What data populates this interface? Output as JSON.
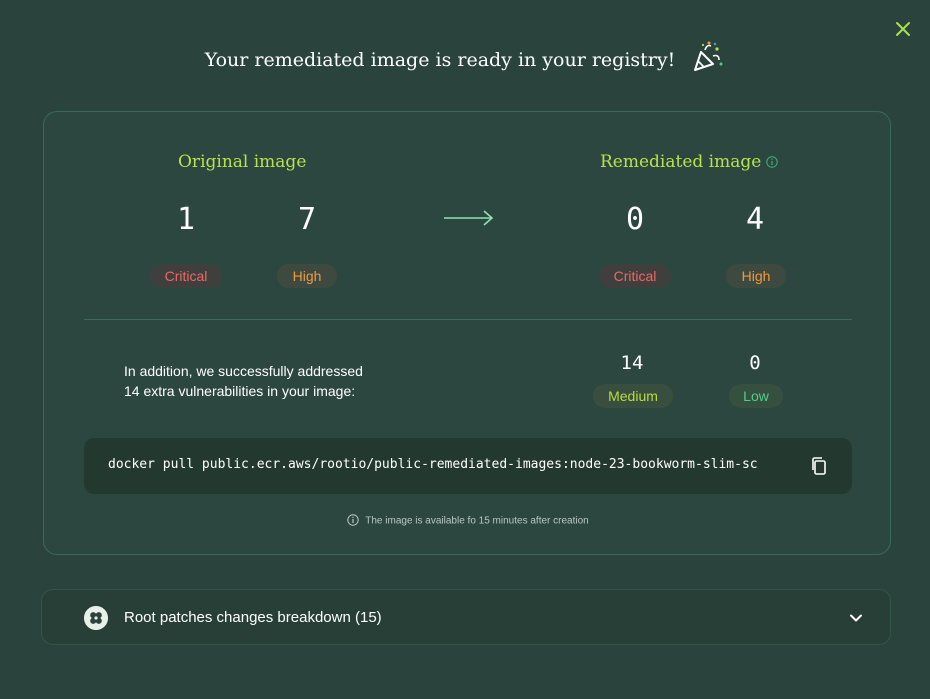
{
  "header": {
    "title": "Your remediated image is ready in your registry!",
    "close_icon": "close-icon",
    "celebration_icon": "party-popper-icon"
  },
  "original": {
    "title": "Original image",
    "critical_count": "1",
    "high_count": "7",
    "critical_label": "Critical",
    "high_label": "High"
  },
  "remediated": {
    "title": "Remediated image",
    "critical_count": "0",
    "high_count": "4",
    "critical_label": "Critical",
    "high_label": "High"
  },
  "addition": {
    "line1": "In addition, we successfully addressed",
    "line2": "14 extra vulnerabilities in your image:",
    "medium_count": "14",
    "low_count": "0",
    "medium_label": "Medium",
    "low_label": "Low"
  },
  "command": {
    "text": "docker pull public.ecr.aws/rootio/public-remediated-images:node-23-bookworm-slim-sc",
    "copy_icon": "copy-icon"
  },
  "note": {
    "text": "The image is available fo 15 minutes after creation"
  },
  "accordion": {
    "label": "Root patches changes breakdown (15)"
  },
  "colors": {
    "background": "#2a443d",
    "accent_green": "#b7e34e",
    "critical": "#f06565",
    "high": "#f09a3a",
    "medium": "#b7dd3a",
    "low": "#4fcf8a"
  }
}
